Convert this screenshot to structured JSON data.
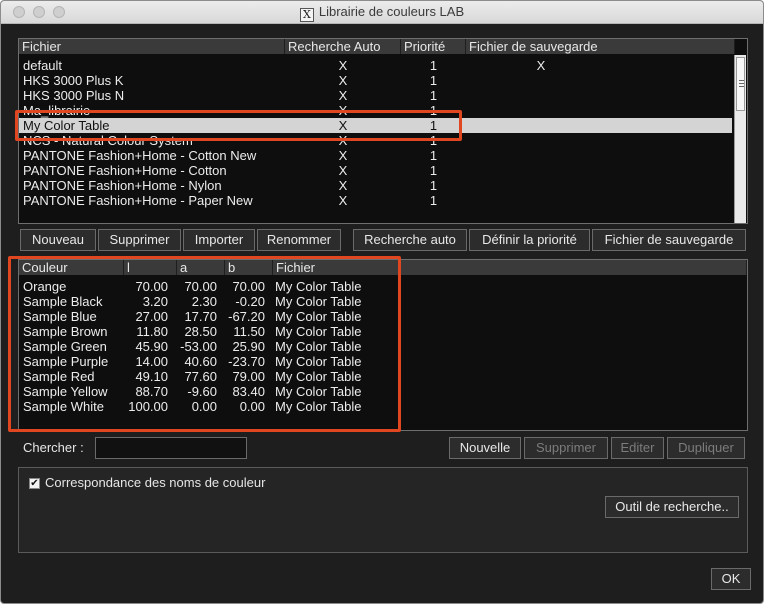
{
  "window": {
    "title": "Librairie de couleurs LAB"
  },
  "libraries": {
    "columns": [
      "Fichier",
      "Recherche Auto",
      "Priorité",
      "Fichier de sauvegarde"
    ],
    "rows": [
      {
        "name": "default",
        "auto": "X",
        "priority": "1",
        "backup": "X"
      },
      {
        "name": "HKS 3000 Plus K",
        "auto": "X",
        "priority": "1",
        "backup": ""
      },
      {
        "name": "HKS 3000 Plus N",
        "auto": "X",
        "priority": "1",
        "backup": ""
      },
      {
        "name": "Ma_librairie",
        "auto": "X",
        "priority": "1",
        "backup": ""
      },
      {
        "name": "My Color Table",
        "auto": "X",
        "priority": "1",
        "backup": ""
      },
      {
        "name": "NCS - Natural Colour System",
        "auto": "X",
        "priority": "1",
        "backup": ""
      },
      {
        "name": "PANTONE Fashion+Home - Cotton New",
        "auto": "X",
        "priority": "1",
        "backup": ""
      },
      {
        "name": "PANTONE Fashion+Home - Cotton",
        "auto": "X",
        "priority": "1",
        "backup": ""
      },
      {
        "name": "PANTONE Fashion+Home - Nylon",
        "auto": "X",
        "priority": "1",
        "backup": ""
      },
      {
        "name": "PANTONE Fashion+Home - Paper New",
        "auto": "X",
        "priority": "1",
        "backup": ""
      }
    ],
    "selected": "My Color Table",
    "buttons": {
      "new": "Nouveau",
      "delete": "Supprimer",
      "import": "Importer",
      "rename": "Renommer",
      "auto_search": "Recherche auto",
      "set_priority": "Définir la priorité",
      "backup_file": "Fichier de sauvegarde"
    }
  },
  "colors": {
    "columns": [
      "Couleur",
      "l",
      "a",
      "b",
      "Fichier"
    ],
    "rows": [
      {
        "name": "Orange",
        "l": "70.00",
        "a": "70.00",
        "b": "70.00",
        "file": "My Color Table"
      },
      {
        "name": "Sample  Black",
        "l": "3.20",
        "a": "2.30",
        "b": "-0.20",
        "file": "My Color Table"
      },
      {
        "name": "Sample  Blue",
        "l": "27.00",
        "a": "17.70",
        "b": "-67.20",
        "file": "My Color Table"
      },
      {
        "name": "Sample  Brown",
        "l": "11.80",
        "a": "28.50",
        "b": "11.50",
        "file": "My Color Table"
      },
      {
        "name": "Sample  Green",
        "l": "45.90",
        "a": "-53.00",
        "b": "25.90",
        "file": "My Color Table"
      },
      {
        "name": "Sample  Purple",
        "l": "14.00",
        "a": "40.60",
        "b": "-23.70",
        "file": "My Color Table"
      },
      {
        "name": "Sample  Red",
        "l": "49.10",
        "a": "77.60",
        "b": "79.00",
        "file": "My Color Table"
      },
      {
        "name": "Sample  Yellow",
        "l": "88.70",
        "a": "-9.60",
        "b": "83.40",
        "file": "My Color Table"
      },
      {
        "name": "Sample White",
        "l": "100.00",
        "a": "0.00",
        "b": "0.00",
        "file": "My Color Table"
      }
    ]
  },
  "search": {
    "label": "Chercher  :",
    "value": "",
    "buttons": {
      "new": "Nouvelle",
      "delete": "Supprimer",
      "edit": "Editer",
      "duplicate": "Dupliquer"
    }
  },
  "options": {
    "match_names_label": "Correspondance des noms de couleur",
    "match_names_checked": true,
    "search_tool_button": "Outil de recherche.."
  },
  "ok_button": "OK",
  "colors_accent": {
    "highlight": "#e0461f",
    "selection": "#d4d4d4"
  }
}
